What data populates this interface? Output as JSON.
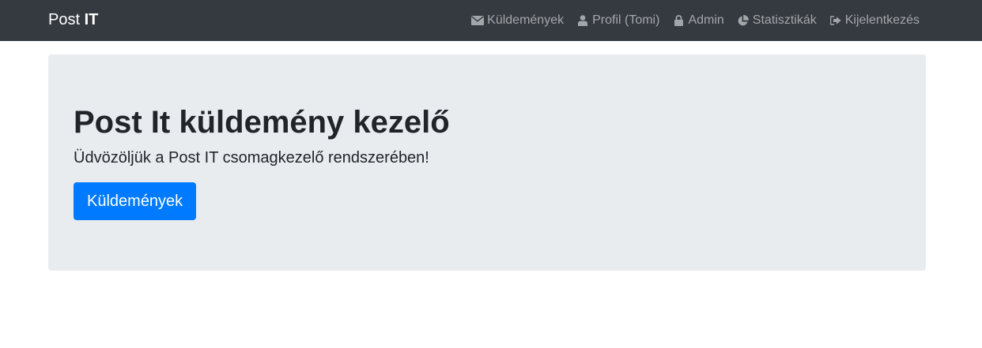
{
  "navbar": {
    "brand_regular": "Post ",
    "brand_bold": "IT",
    "links": [
      {
        "label": "Küldemények",
        "icon": "envelope-icon"
      },
      {
        "label": "Profil (Tomi)",
        "icon": "user-icon"
      },
      {
        "label": "Admin",
        "icon": "lock-icon"
      },
      {
        "label": "Statisztikák",
        "icon": "pie-chart-icon"
      },
      {
        "label": "Kijelentkezés",
        "icon": "sign-out-icon"
      }
    ]
  },
  "jumbotron": {
    "title": "Post It küldemény kezelő",
    "lead": "Üdvözöljük a Post IT csomagkezelő rendszerében!",
    "button_label": "Küldemények"
  },
  "colors": {
    "navbar_bg": "#343a40",
    "jumbotron_bg": "#e9ecef",
    "primary": "#007bff",
    "nav_link": "rgba(255,255,255,0.55)"
  }
}
